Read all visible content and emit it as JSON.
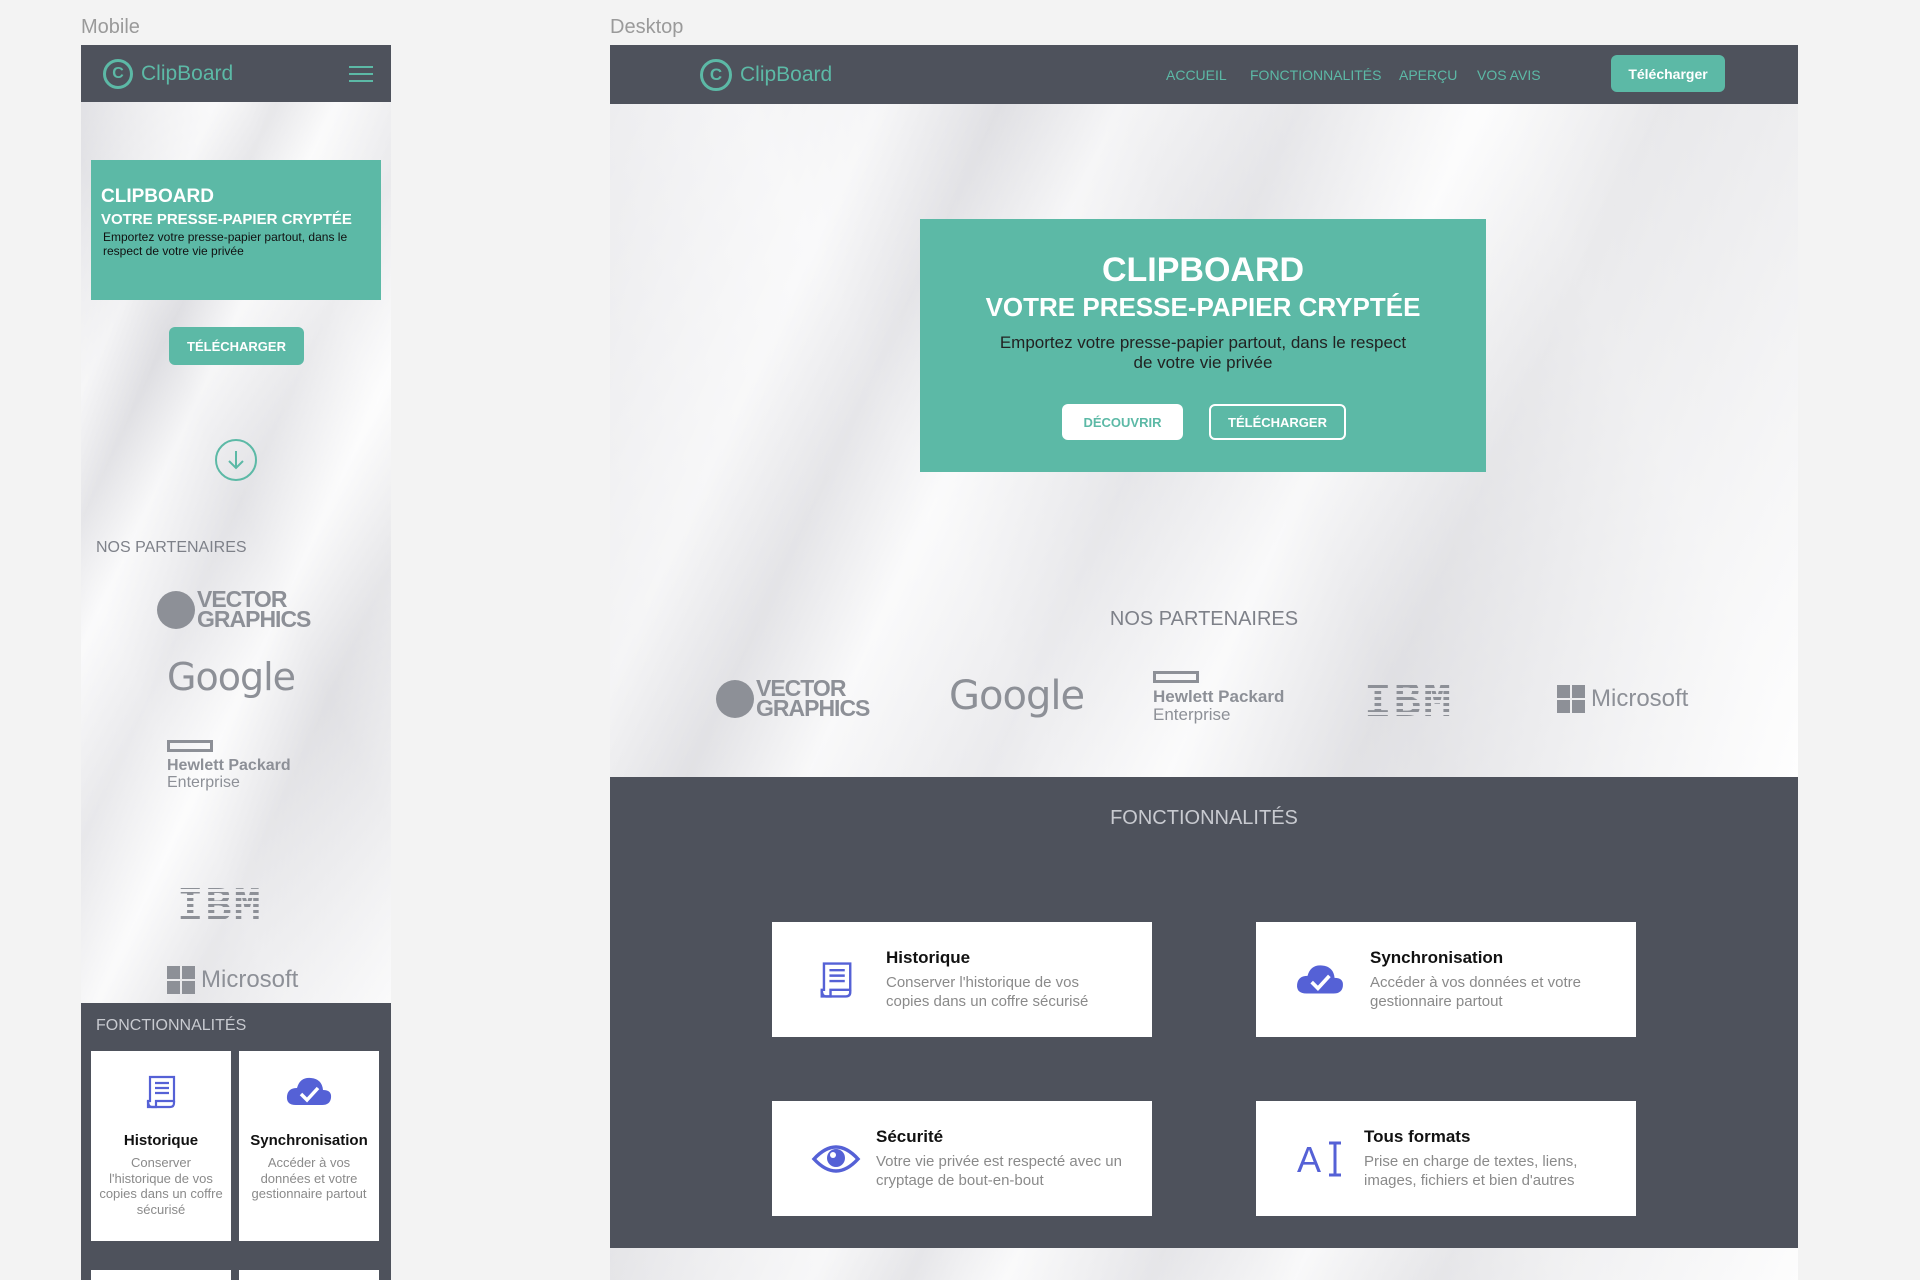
{
  "labels": {
    "mobile": "Mobile",
    "desktop": "Desktop"
  },
  "brand": {
    "name": "ClipBoard",
    "logo_letter": "C",
    "accent": "#5cb9a6",
    "nav_bg": "#4e525c"
  },
  "nav": {
    "links": [
      "ACCUEIL",
      "FONCTIONNALITÉS",
      "APERÇU",
      "VOS AVIS"
    ],
    "download": "Télécharger"
  },
  "hero": {
    "title": "CLIPBOARD",
    "subtitle": "VOTRE PRESSE-PAPIER CRYPTÉE",
    "tagline": "Emportez votre presse-papier partout, dans le respect de votre vie privée",
    "discover": "DÉCOUVRIR",
    "download": "TÉLÉCHARGER"
  },
  "partners": {
    "title": "NOS PARTENAIRES",
    "vector": [
      "VECTOR",
      "GRAPHICS"
    ],
    "google": "Google",
    "hpe": [
      "Hewlett Packard",
      "Enterprise"
    ],
    "ibm": "IBM",
    "microsoft": "Microsoft"
  },
  "features": {
    "title": "FONCTIONNALITÉS",
    "items": [
      {
        "icon": "scroll-icon",
        "title": "Historique",
        "desc": "Conserver l'historique de vos copies dans un coffre sécurisé",
        "mobile_desc": "Conserver l'historique de vos copies dans un coffre sécurisé"
      },
      {
        "icon": "cloud-check-icon",
        "title": "Synchronisation",
        "desc": "Accéder à vos données et votre gestionnaire partout",
        "mobile_desc": "Accéder à vos données et votre gestionnaire partout"
      },
      {
        "icon": "eye-icon",
        "title": "Sécurité",
        "desc": "Votre vie privée est respecté avec un cryptage de bout-en-bout"
      },
      {
        "icon": "text-format-icon",
        "title": "Tous formats",
        "desc": "Prise en charge de textes, liens, images, fichiers et bien d'autres"
      }
    ]
  }
}
